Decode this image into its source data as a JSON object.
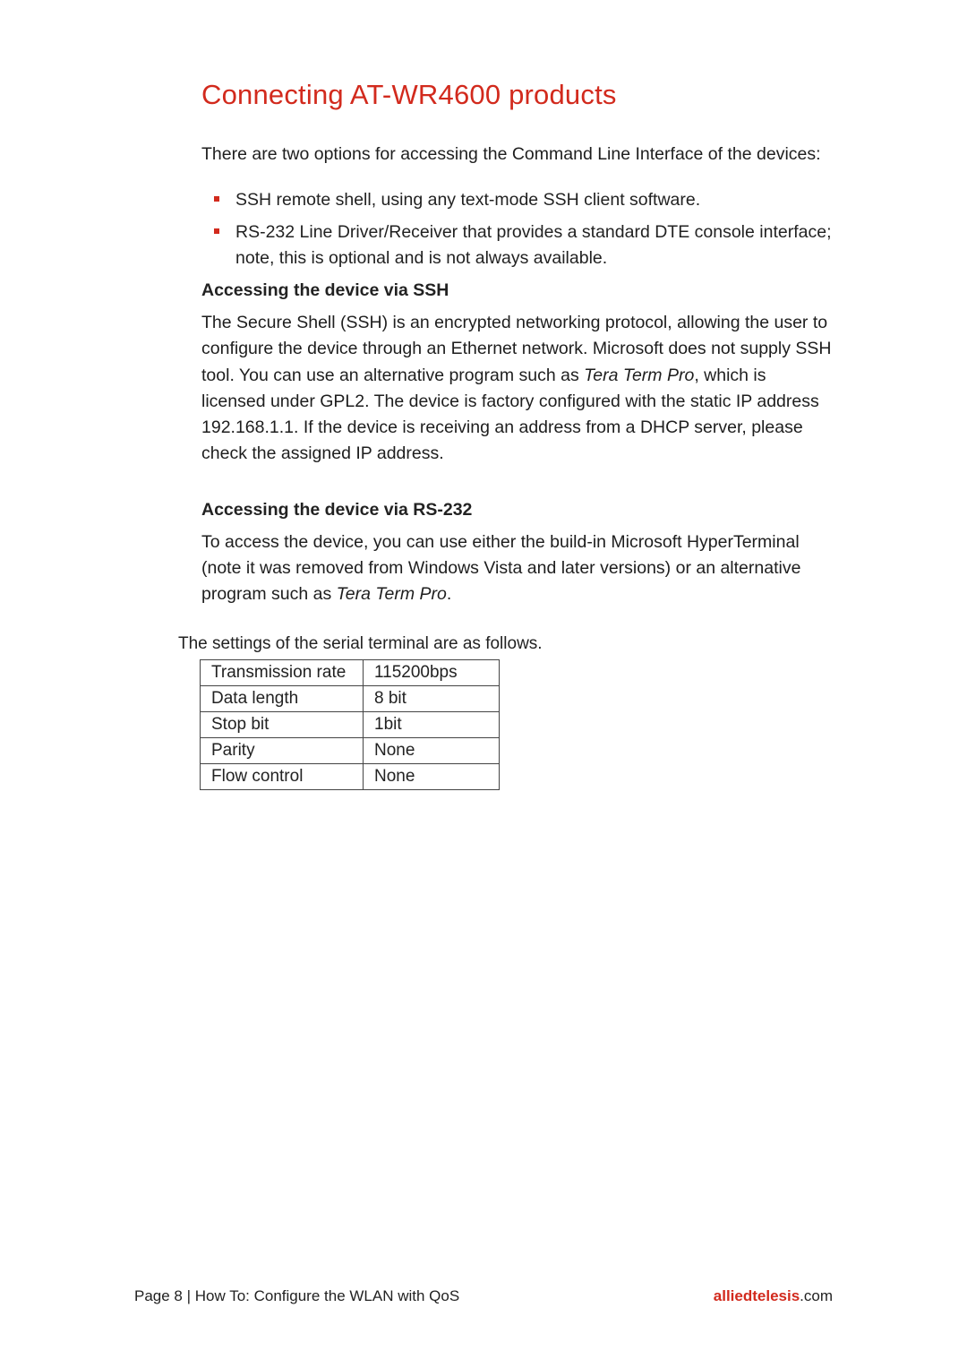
{
  "heading": "Connecting AT-WR4600 products",
  "intro": "There are two options for accessing the Command Line Interface of the devices:",
  "bullets": [
    "SSH remote shell, using any text-mode SSH client software.",
    "RS-232 Line Driver/Receiver that provides a standard DTE console interface; note, this is optional and is not always available."
  ],
  "ssh": {
    "heading": "Accessing the device via SSH",
    "p1a": "The Secure Shell (SSH) is an encrypted networking protocol, allowing the user to configure the device through an Ethernet network. Microsoft does not supply SSH tool. You can use an alternative program such as ",
    "p1_italic": "Tera Term Pro",
    "p1b": ", which is licensed under GPL2. The device is factory configured with the static IP address 192.168.1.1. If the device is receiving an address from a DHCP server, please check the assigned IP address."
  },
  "rs232": {
    "heading": "Accessing the device via RS-232",
    "p1a": "To access the device, you can use either the build-in Microsoft HyperTerminal (note it was removed from Windows Vista and later versions) or an alternative program such as ",
    "p1_italic": "Tera Term Pro",
    "p1b": "."
  },
  "table_intro": "The settings of the serial terminal are as follows.",
  "table": {
    "rows": [
      {
        "label": "Transmission rate",
        "value": "115200bps"
      },
      {
        "label": "Data length",
        "value": "8 bit"
      },
      {
        "label": "Stop bit",
        "value": "1bit"
      },
      {
        "label": "Parity",
        "value": "None"
      },
      {
        "label": "Flow control",
        "value": "None"
      }
    ]
  },
  "footer": {
    "page_label": "Page 8",
    "separator": " | ",
    "doc_title": "How To: Configure the WLAN with QoS",
    "brand": "alliedtelesis",
    "dotcom": ".com"
  }
}
